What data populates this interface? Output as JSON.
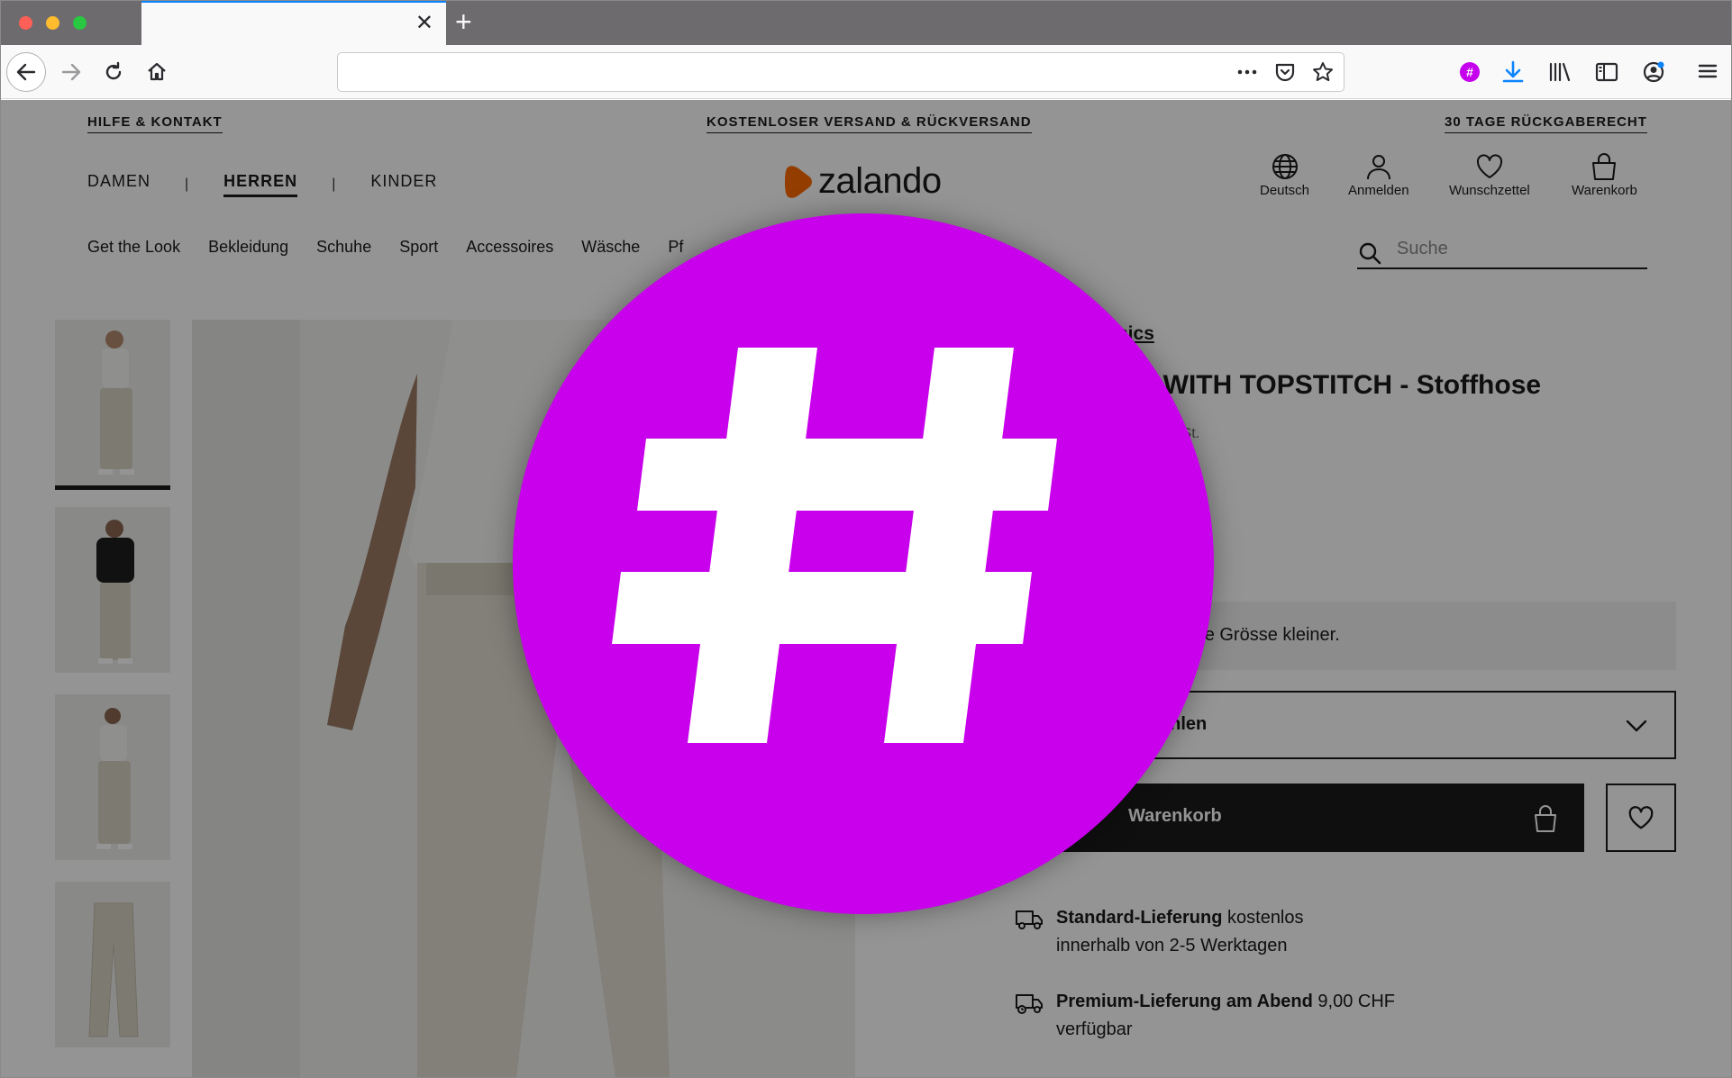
{
  "browser": {
    "tab_close": "✕",
    "new_tab": "+",
    "url": ""
  },
  "topbar": {
    "help": "HILFE & KONTAKT",
    "shipping": "KOSTENLOSER VERSAND & RÜCKVERSAND",
    "returns": "30 TAGE RÜCKGABERECHT"
  },
  "gender_nav": {
    "items": [
      "DAMEN",
      "HERREN",
      "KINDER"
    ],
    "separator": "|",
    "active": "HERREN"
  },
  "logo": {
    "text": "zalando",
    "color": "#ff6900"
  },
  "account_nav": {
    "language": "Deutsch",
    "login": "Anmelden",
    "wishlist": "Wunschzettel",
    "cart": "Warenkorb"
  },
  "categories": [
    "Get the Look",
    "Bekleidung",
    "Schuhe",
    "Sport",
    "Accessoires",
    "Wäsche",
    "Pf"
  ],
  "search": {
    "placeholder": "Suche"
  },
  "product": {
    "brand_partial": "sics",
    "title_partial": "T WITH TOPSTITCH - Stoffhose",
    "vat_partial": "wSt.",
    "fit_hint_partial": "eine Grösse kleiner.",
    "size_select_partial": "ählen",
    "add_to_cart_partial": "Warenkorb"
  },
  "delivery": [
    {
      "title": "Standard-Lieferung",
      "suffix": " kostenlos",
      "line2": "innerhalb von 2-5 Werktagen"
    },
    {
      "title": "Premium-Lieferung am Abend",
      "suffix": " 9,00 CHF",
      "line2": "verfügbar"
    }
  ],
  "overlay": {
    "symbol": "#",
    "color": "#c800eb"
  },
  "colors": {
    "accent": "#0a84ff",
    "overlay_magenta": "#c800eb",
    "brand_orange": "#ff6900"
  }
}
